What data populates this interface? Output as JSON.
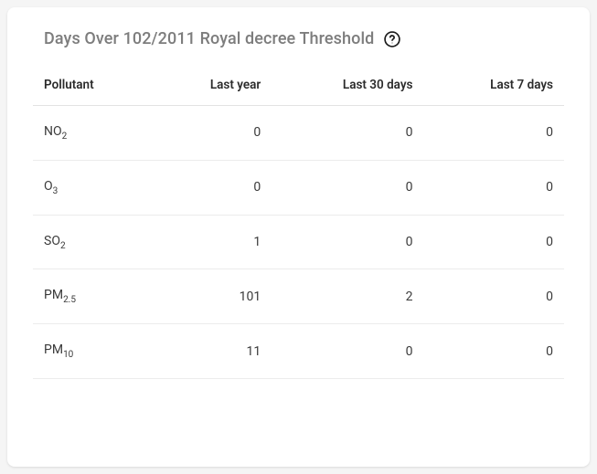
{
  "header": {
    "title": "Days Over 102/2011 Royal decree Threshold"
  },
  "table": {
    "columns": [
      "Pollutant",
      "Last year",
      "Last 30 days",
      "Last 7 days"
    ],
    "rows": [
      {
        "pollutant": "NO",
        "sub": "2",
        "last_year": 0,
        "last_30_days": 0,
        "last_7_days": 0
      },
      {
        "pollutant": "O",
        "sub": "3",
        "last_year": 0,
        "last_30_days": 0,
        "last_7_days": 0
      },
      {
        "pollutant": "SO",
        "sub": "2",
        "last_year": 1,
        "last_30_days": 0,
        "last_7_days": 0
      },
      {
        "pollutant": "PM",
        "sub": "2.5",
        "last_year": 101,
        "last_30_days": 2,
        "last_7_days": 0
      },
      {
        "pollutant": "PM",
        "sub": "10",
        "last_year": 11,
        "last_30_days": 0,
        "last_7_days": 0
      }
    ]
  },
  "chart_data": {
    "type": "table",
    "title": "Days Over 102/2011 Royal decree Threshold",
    "columns": [
      "Pollutant",
      "Last year",
      "Last 30 days",
      "Last 7 days"
    ],
    "rows": [
      {
        "pollutant": "NO2",
        "last_year": 0,
        "last_30_days": 0,
        "last_7_days": 0
      },
      {
        "pollutant": "O3",
        "last_year": 0,
        "last_30_days": 0,
        "last_7_days": 0
      },
      {
        "pollutant": "SO2",
        "last_year": 1,
        "last_30_days": 0,
        "last_7_days": 0
      },
      {
        "pollutant": "PM2.5",
        "last_year": 101,
        "last_30_days": 2,
        "last_7_days": 0
      },
      {
        "pollutant": "PM10",
        "last_year": 11,
        "last_30_days": 0,
        "last_7_days": 0
      }
    ]
  }
}
